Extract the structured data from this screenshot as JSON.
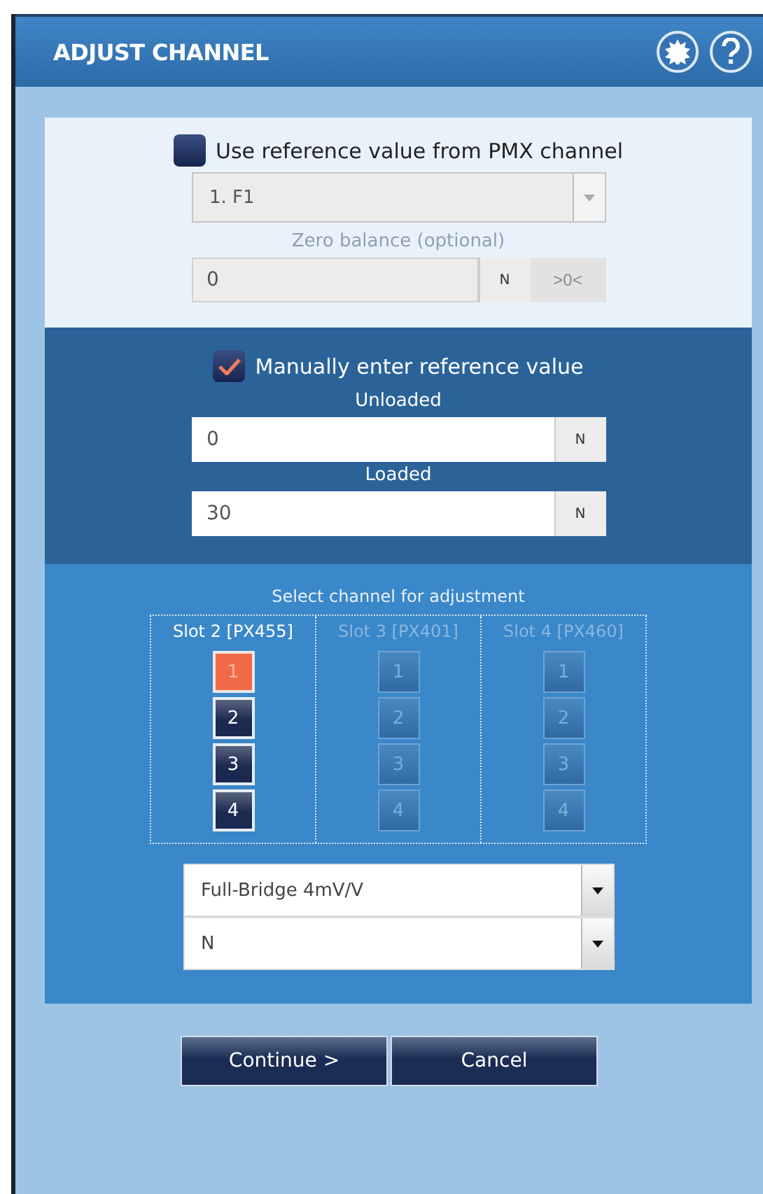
{
  "window": {
    "title": "ADJUST CHANNEL"
  },
  "reference_section": {
    "checkbox": {
      "label": "Use reference value from PMX channel",
      "checked": false
    },
    "disabled": true,
    "channel_select": {
      "value": "1. F1"
    },
    "zero_balance": {
      "label": "Zero balance (optional)",
      "value": "0",
      "unit": "N",
      "button": ">0<"
    }
  },
  "manual_section": {
    "checkbox": {
      "label": "Manually enter reference value",
      "checked": true
    },
    "fields": [
      {
        "label": "Unloaded",
        "value": "0",
        "unit": "N"
      },
      {
        "label": "Loaded",
        "value": "30",
        "unit": "N"
      }
    ]
  },
  "channel_section": {
    "title": "Select channel for adjustment",
    "slots": [
      {
        "label": "Slot 2 [PX455]",
        "enabled": true,
        "channels": [
          {
            "label": "1",
            "selected": true
          },
          {
            "label": "2",
            "selected": false
          },
          {
            "label": "3",
            "selected": false
          },
          {
            "label": "4",
            "selected": false
          }
        ]
      },
      {
        "label": "Slot 3 [PX401]",
        "enabled": false,
        "channels": [
          {
            "label": "1",
            "selected": false
          },
          {
            "label": "2",
            "selected": false
          },
          {
            "label": "3",
            "selected": false
          },
          {
            "label": "4",
            "selected": false
          }
        ]
      },
      {
        "label": "Slot 4 [PX460]",
        "enabled": false,
        "channels": [
          {
            "label": "1",
            "selected": false
          },
          {
            "label": "2",
            "selected": false
          },
          {
            "label": "3",
            "selected": false
          },
          {
            "label": "4",
            "selected": false
          }
        ]
      }
    ],
    "sensor_select": {
      "value": "Full-Bridge 4mV/V"
    },
    "unit_select": {
      "value": "N"
    }
  },
  "buttons": [
    {
      "label": "Continue >"
    },
    {
      "label": "Cancel"
    }
  ]
}
